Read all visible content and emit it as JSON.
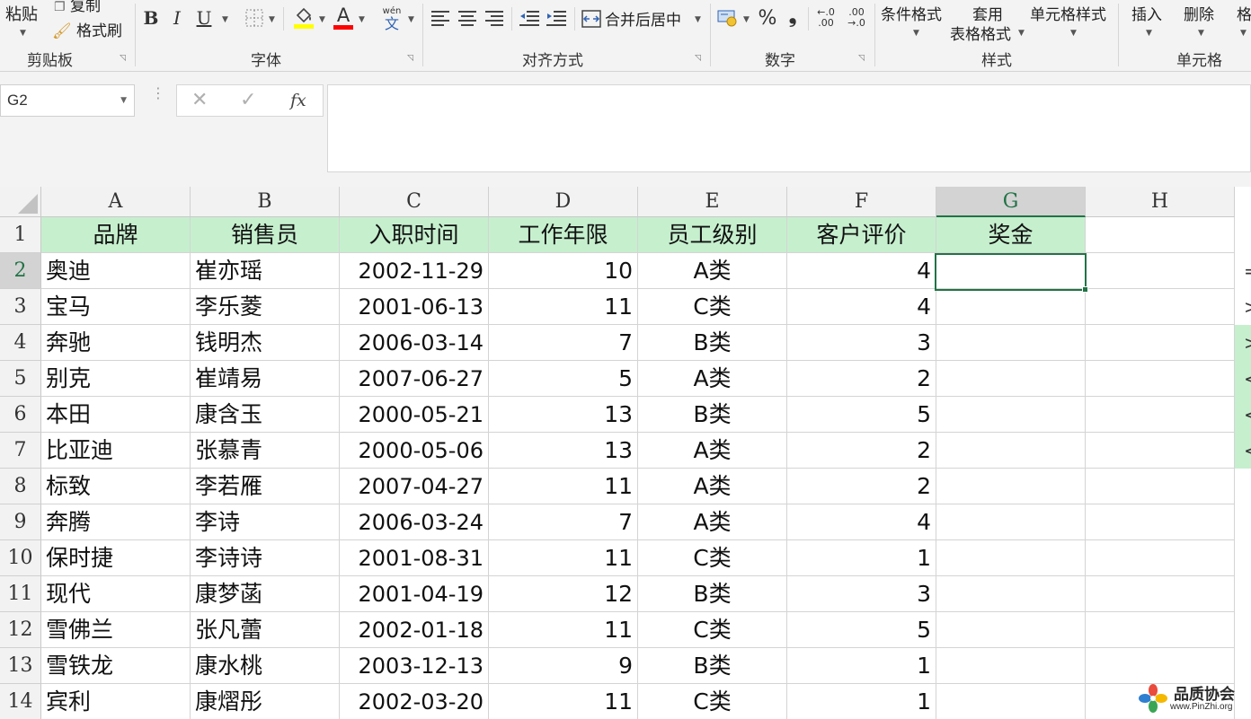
{
  "ribbon": {
    "clipboard": {
      "paste_label": "粘贴",
      "copy_label": "复制",
      "format_painter_label": "格式刷",
      "group_label": "剪贴板"
    },
    "font": {
      "bold_label": "B",
      "italic_label": "I",
      "underline_label": "U",
      "font_color_label": "A",
      "phonetic_top": "wén",
      "phonetic_bottom": "文",
      "group_label": "字体"
    },
    "alignment": {
      "merge_center_label": "合并后居中",
      "group_label": "对齐方式"
    },
    "number": {
      "percent_label": "%",
      "comma_label": "❟",
      "inc_decimal_top": "←.0",
      "inc_decimal_bottom": ".00",
      "dec_decimal_top": ".00",
      "dec_decimal_bottom": "→.0",
      "group_label": "数字"
    },
    "styles": {
      "conditional_label": "条件格式",
      "table_format_line1": "套用",
      "table_format_line2": "表格格式",
      "cell_styles_label": "单元格样式",
      "group_label": "样式"
    },
    "cells": {
      "insert_label": "插入",
      "delete_label": "删除",
      "format_label": "格",
      "group_label": "单元格"
    },
    "colors": {
      "highlight": "#ffff00",
      "font_red": "#ff0000",
      "accent_green": "#217346",
      "header_fill": "#c6efce"
    }
  },
  "formula_bar": {
    "name_box": "G2",
    "cancel_icon": "✕",
    "enter_icon": "✓",
    "fx_label": "fx",
    "formula": ""
  },
  "grid": {
    "active_cell": "G2",
    "columns": [
      "A",
      "B",
      "C",
      "D",
      "E",
      "F",
      "G",
      "H"
    ],
    "rows": [
      "1",
      "2",
      "3",
      "4",
      "5",
      "6",
      "7",
      "8",
      "9",
      "10",
      "11",
      "12",
      "13",
      "14"
    ],
    "header": [
      "品牌",
      "销售员",
      "入职时间",
      "工作年限",
      "员工级别",
      "客户评价",
      "奖金"
    ],
    "data": [
      [
        "奥迪",
        "崔亦瑶",
        "2002-11-29",
        "10",
        "A类",
        "4",
        ""
      ],
      [
        "宝马",
        "李乐菱",
        "2001-06-13",
        "11",
        "C类",
        "4",
        ""
      ],
      [
        "奔驰",
        "钱明杰",
        "2006-03-14",
        "7",
        "B类",
        "3",
        ""
      ],
      [
        "别克",
        "崔靖易",
        "2007-06-27",
        "5",
        "A类",
        "2",
        ""
      ],
      [
        "本田",
        "康含玉",
        "2000-05-21",
        "13",
        "B类",
        "5",
        ""
      ],
      [
        "比亚迪",
        "张慕青",
        "2000-05-06",
        "13",
        "A类",
        "2",
        ""
      ],
      [
        "标致",
        "李若雁",
        "2007-04-27",
        "11",
        "A类",
        "2",
        ""
      ],
      [
        "奔腾",
        "李诗",
        "2006-03-24",
        "7",
        "A类",
        "4",
        ""
      ],
      [
        "保时捷",
        "李诗诗",
        "2001-08-31",
        "11",
        "C类",
        "1",
        ""
      ],
      [
        "现代",
        "康梦菡",
        "2001-04-19",
        "12",
        "B类",
        "3",
        ""
      ],
      [
        "雪佛兰",
        "张凡蕾",
        "2002-01-18",
        "11",
        "C类",
        "5",
        ""
      ],
      [
        "雪铁龙",
        "康水桃",
        "2003-12-13",
        "9",
        "B类",
        "1",
        ""
      ],
      [
        "宾利",
        "康熠彤",
        "2002-03-20",
        "11",
        "C类",
        "1",
        ""
      ]
    ],
    "side_fragments": [
      "=",
      ">",
      ">",
      "<",
      "<",
      "<"
    ]
  },
  "watermark": {
    "title": "品质协会",
    "url": "www.PinZhi.org"
  }
}
